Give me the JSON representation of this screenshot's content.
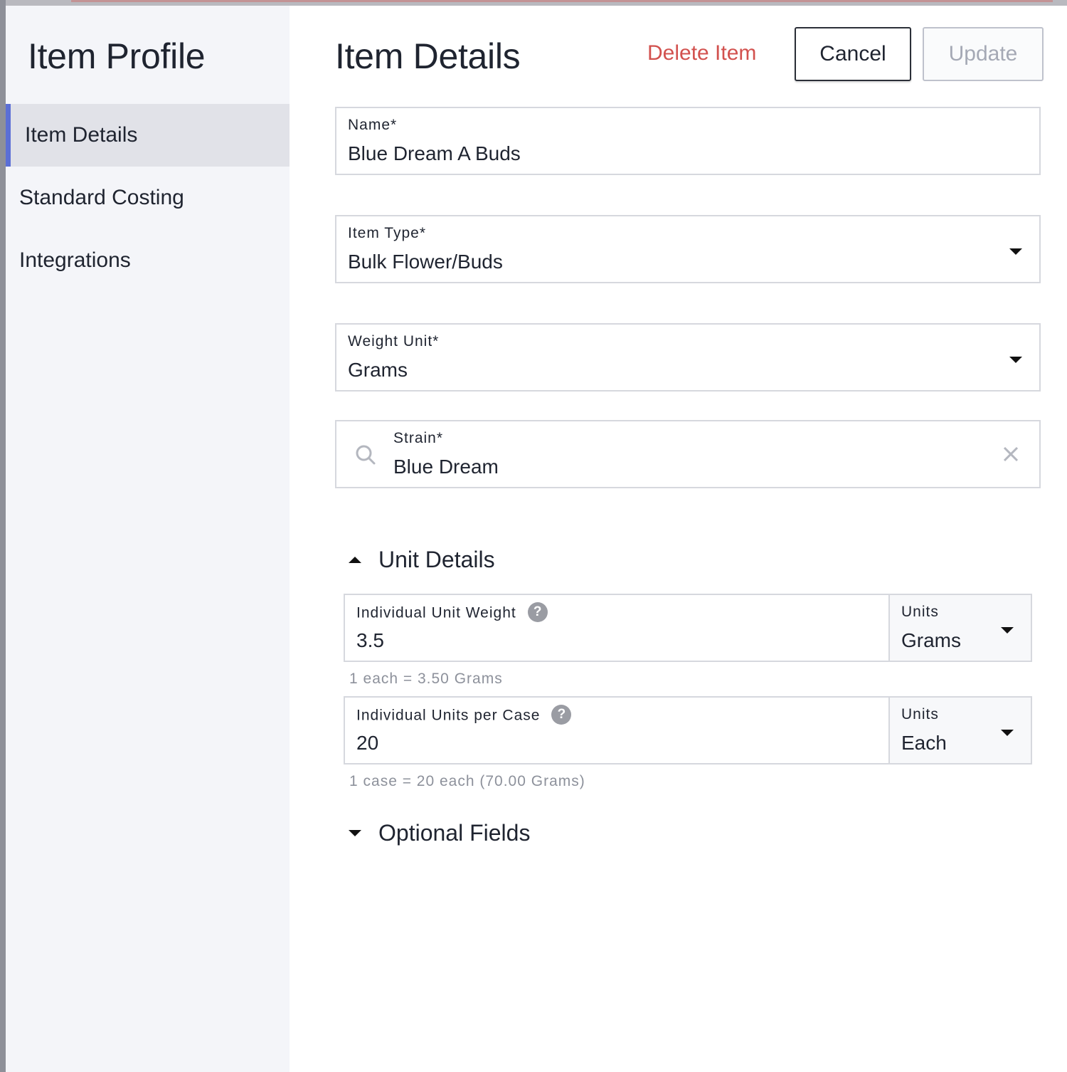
{
  "sidebar": {
    "title": "Item Profile",
    "items": [
      {
        "label": "Item Details",
        "active": true
      },
      {
        "label": "Standard Costing",
        "active": false
      },
      {
        "label": "Integrations",
        "active": false
      }
    ]
  },
  "header": {
    "title": "Item Details",
    "delete_label": "Delete Item",
    "cancel_label": "Cancel",
    "update_label": "Update"
  },
  "form": {
    "name": {
      "label": "Name*",
      "value": "Blue Dream A Buds"
    },
    "item_type": {
      "label": "Item Type*",
      "value": "Bulk Flower/Buds"
    },
    "weight_unit": {
      "label": "Weight Unit*",
      "value": "Grams"
    },
    "strain": {
      "label": "Strain*",
      "value": "Blue Dream"
    }
  },
  "unit_details": {
    "heading": "Unit Details",
    "unit_weight": {
      "label": "Individual Unit Weight",
      "value": "3.5",
      "units_label": "Units",
      "units_value": "Grams",
      "hint": "1 each = 3.50 Grams"
    },
    "units_per_case": {
      "label": "Individual Units per Case",
      "value": "20",
      "units_label": "Units",
      "units_value": "Each",
      "hint": "1 case = 20 each (70.00 Grams)"
    }
  },
  "optional": {
    "heading": "Optional Fields"
  },
  "icons": {
    "help": "?"
  },
  "colors": {
    "accent": "#5b6fd6",
    "danger": "#d2514e",
    "sidebar_bg": "#f4f5f9"
  }
}
